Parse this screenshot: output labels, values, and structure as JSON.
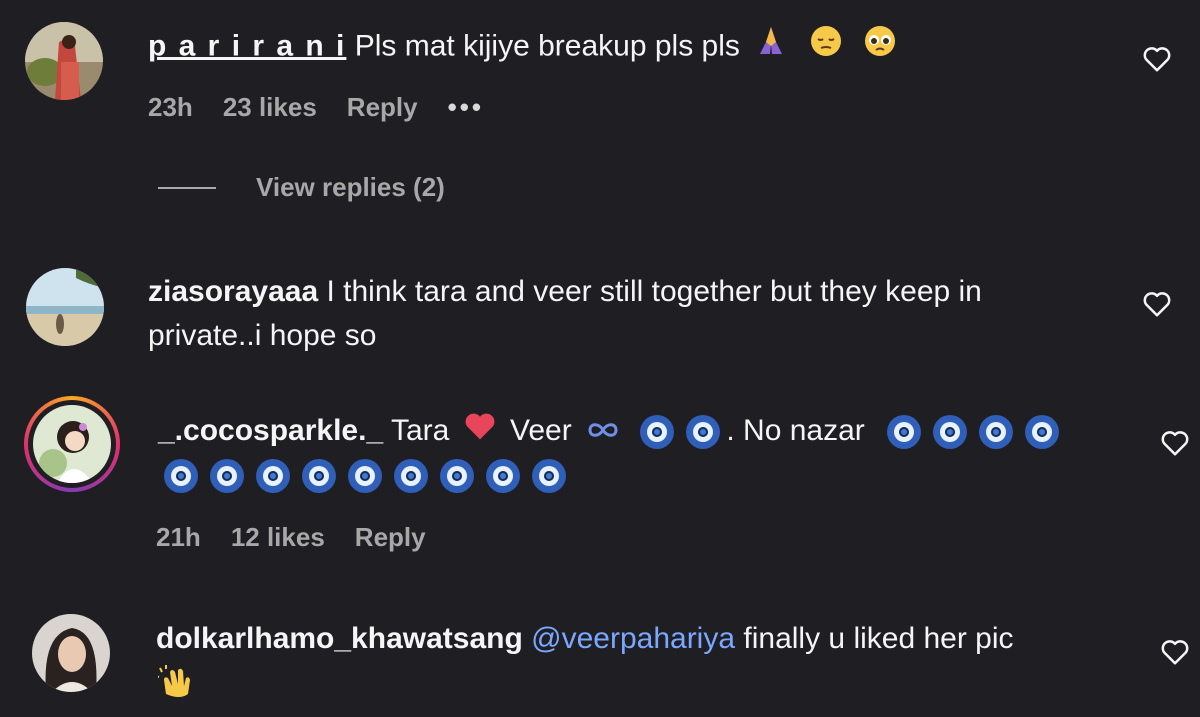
{
  "comments": [
    {
      "username": "p a r i r a n i",
      "text": "Pls mat kijiye breakup pls pls",
      "emojis": [
        "folded-hands",
        "pensive-face",
        "pleading-face"
      ],
      "time": "23h",
      "likes": "23 likes",
      "reply": "Reply",
      "more": "•••",
      "view_replies": "View replies (2)"
    },
    {
      "username": "ziasorayaaa",
      "text_line1": "I think tara and veer still together but they keep in",
      "text_line2": "private..i hope so"
    },
    {
      "username": "_.cocosparkle._",
      "text_part1": "Tara",
      "text_part2": "Veer",
      "text_part3": ". No nazar",
      "emojis": [
        "red-heart",
        "infinity",
        "nazar-amulet"
      ],
      "time": "21h",
      "likes": "12 likes",
      "reply": "Reply"
    },
    {
      "username": "dolkarlhamo_khawatsang",
      "mention": "@veerpahariya",
      "text": "finally u liked her pic",
      "emojis": [
        "clapping-hands"
      ]
    }
  ],
  "colors": {
    "background": "#1f1f23",
    "text": "#f5f5f5",
    "secondary": "#a8a8a8",
    "mention": "#7aa7ff",
    "story_ring": [
      "#f9a825",
      "#e1306c",
      "#833ab4"
    ]
  }
}
